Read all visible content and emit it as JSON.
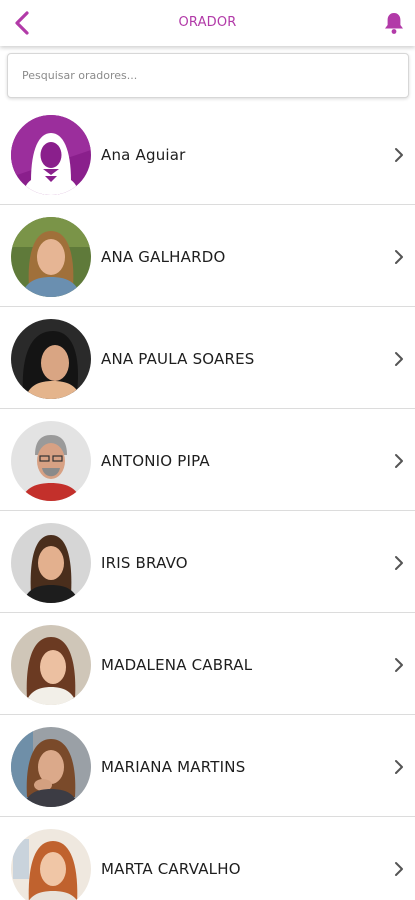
{
  "header": {
    "title": "ORADOR",
    "back_icon": "chevron-left-icon",
    "notification_icon": "bell-icon",
    "accent_color": "#b23aa8"
  },
  "search": {
    "placeholder": "Pesquisar oradores...",
    "value": ""
  },
  "speakers": [
    {
      "name": "Ana Aguiar"
    },
    {
      "name": "ANA GALHARDO"
    },
    {
      "name": "ANA PAULA SOARES"
    },
    {
      "name": "ANTONIO PIPA"
    },
    {
      "name": "IRIS BRAVO"
    },
    {
      "name": "MADALENA CABRAL"
    },
    {
      "name": "MARIANA MARTINS"
    },
    {
      "name": "MARTA CARVALHO"
    }
  ]
}
